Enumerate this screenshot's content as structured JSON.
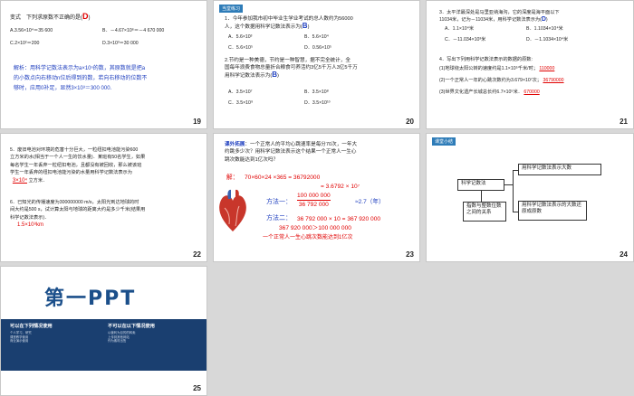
{
  "slides": {
    "s19": {
      "num": "19",
      "q_prefix": "变式　下列求原数不正确的是(",
      "q_answer": "D",
      "q_suffix": ")",
      "optA": "A.3.56×10⁴＝35 600",
      "optB": "B．－4.67×10⁶＝－4 670 000",
      "optC": "C.2×10²＝200",
      "optD": "D.3×10³＝30 000",
      "explain1": "解析：用科学记数法表示为a×10ⁿ的数，其原数就是把a",
      "explain2": "的小数点向右移动n位后得到的数，若向右移动的位数不",
      "explain3": "够时，应用0补足，显然3×10³＝300 000."
    },
    "s20": {
      "num": "20",
      "tag": "当堂练习",
      "q1a": "1．今年参加我市初中毕业生学业考试的总人数约为56000",
      "q1b": "人，这个数据用科学记数法表示为(",
      "q1ans": "B",
      "q1c": ")",
      "q1A": "A．5.6×10³",
      "q1B": "B．5.6×10⁴",
      "q1C": "C．5.6×10⁵",
      "q1D": "D．0.56×10⁵",
      "q2a": "2.节约是一种美德，节约是一种智慧，据不完全统计，全",
      "q2b": "国每年浪费食物总量折合粮食可养活约3亿5千万人3亿5千万",
      "q2c": "用科学记数法表示为(",
      "q2ans": "B",
      "q2d": ")",
      "q2A": "A．3.5×10⁷",
      "q2B": "B．3.5×10⁸",
      "q2C": "C．3.5×10⁹",
      "q2D": "D．3.5×10¹⁰"
    },
    "s21": {
      "num": "21",
      "q3a": "3．太平洋最深处是马里亚纳海沟，它的深度是海平面以下",
      "q3b": "11034米，记为－11034米，用科学记数法表示为(",
      "q3ans": "D",
      "q3c": ")",
      "q3A": "A．1.1×10⁴米",
      "q3B": "B．1.1034×10⁴米",
      "q3C": "C．－11.034×10³米",
      "q3D": "D．－1.1034×10⁴米",
      "q4": "4．写出下列用科学记数法表示的数据的原数:",
      "q4_1": "(1)地球绕太阳公转的速度约是1.1×10⁵千米/时；",
      "q4_1ans": "110000",
      "q4_2": "(2)一个正常人一年的心跳次数约为3.679×10⁷次；",
      "q4_2ans": "36790000",
      "q4_3": "(3)世界文化遗产长城总长约6.7×10⁵米．",
      "q4_3ans": "670000"
    },
    "s22": {
      "num": "22",
      "q5a": "5．废旧电池对环境的危害十分巨大，一粒纽扣电池能污染600",
      "q5b": "立方米的水(相当于一个人一生的饮水量)．某班有50名学生，如果",
      "q5c": "每名学生一年丢弃一粒纽扣电池，且都没有被回收，那么被该班",
      "q5d": "学生一年丢弃的纽扣电池能污染的水量用科学记数法表示为",
      "q5ans": "3×10⁴",
      "q5e": "立方米．",
      "q6a": "6．已知光的传播速度为300000000 m/s，太阳光到达地球的时",
      "q6b": "间大约是500 s，试计算太阳与地球的距离大约是多少千米(结果用",
      "q6c": "科学记数法表示)．",
      "q6ans": "1.5×10⁸km"
    },
    "s23": {
      "num": "23",
      "tag": "课外拓展",
      "intro1": "：一个正常人的平均心跳速率是每分70次，一年大",
      "intro2": "约跳多少次？用科学记数法表示这个结果一个正常人一生心",
      "intro3": "跳次数能达到1亿次吗？",
      "sol_label": "解：",
      "sol_line1": "70×60×24 ×365 = 36792000",
      "sol_line2": "= 3.6792 × 10⁷",
      "m1_label": "方法一：",
      "m1_num": "100 000 000",
      "m1_den": "36 792 000",
      "m1_res": "≈2.7（年）",
      "m2_label": "方法二：",
      "m2_line1": "36 792 000 × 10 = 367 920 000",
      "m2_line2": "367 920 000＞100 000 000",
      "conclusion": "一个正常人一生心跳次数能达到1亿次"
    },
    "s24": {
      "num": "24",
      "tag": "课堂小结",
      "root": "科学记数法",
      "branch1": "用科学记数法表示大数",
      "branch2": "用科学记数法表示的大数还原成原数",
      "branch3": "指数与整数位数之间的关系"
    },
    "s25": {
      "num": "25",
      "logo": "第一PPT",
      "left_title": "可以在下列情况使用",
      "right_title": "不可以在以下情况使用",
      "left_items": [
        "个人学习、研究",
        "课堂教学使用",
        "商业演示使用"
      ],
      "right_items": [
        "以营利为目的的转卖",
        "上传到其他网站",
        "作为素材出售"
      ]
    }
  },
  "colors": {
    "accent": "#2e7cb8",
    "answer": "#1f3fbf",
    "highlight": "#e00000",
    "logo": "#1b4f8a"
  }
}
